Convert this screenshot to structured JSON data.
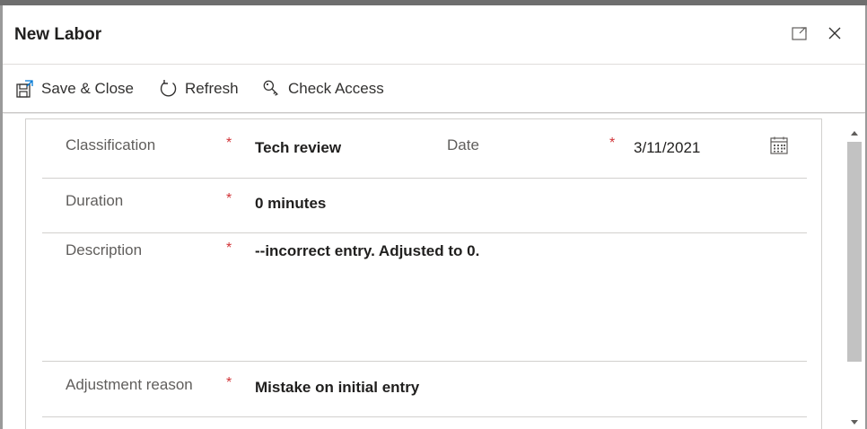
{
  "dialog": {
    "title": "New Labor",
    "expand_icon": "expand-icon",
    "close_icon": "close-icon"
  },
  "toolbar": {
    "save_close_label": "Save & Close",
    "save_close_icon": "save-close-icon",
    "refresh_label": "Refresh",
    "refresh_icon": "refresh-icon",
    "check_access_label": "Check Access",
    "check_access_icon": "key-search-icon"
  },
  "form": {
    "classification": {
      "label": "Classification",
      "required": "*",
      "value": "Tech review"
    },
    "date": {
      "label": "Date",
      "required": "*",
      "value": "3/11/2021",
      "icon": "calendar-icon"
    },
    "duration": {
      "label": "Duration",
      "required": "*",
      "value": "0 minutes"
    },
    "description": {
      "label": "Description",
      "required": "*",
      "value": "--incorrect entry. Adjusted to 0."
    },
    "adjustment_reason": {
      "label": "Adjustment reason",
      "required": "*",
      "value": "Mistake on initial entry"
    }
  },
  "colors": {
    "required": "#d13438",
    "label": "#605e5c",
    "value": "#201f1e",
    "divider": "#d2d0ce"
  }
}
